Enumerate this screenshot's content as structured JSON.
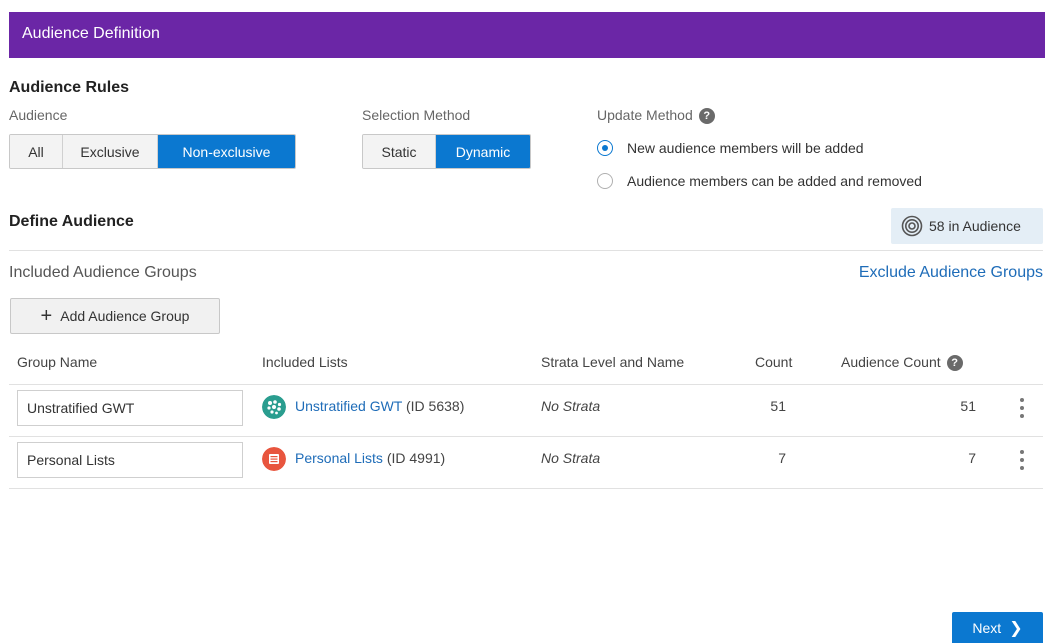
{
  "header": {
    "title": "Audience Definition"
  },
  "audience_rules": {
    "heading": "Audience Rules",
    "audience": {
      "label": "Audience",
      "options": [
        "All",
        "Exclusive",
        "Non-exclusive"
      ],
      "selected": "Non-exclusive"
    },
    "selection_method": {
      "label": "Selection Method",
      "options": [
        "Static",
        "Dynamic"
      ],
      "selected": "Dynamic"
    },
    "update_method": {
      "label": "Update Method",
      "help_icon": "?",
      "options": [
        {
          "label": "New audience members will be added",
          "checked": true
        },
        {
          "label": "Audience members can be added and removed",
          "checked": false
        }
      ]
    }
  },
  "define_audience": {
    "heading": "Define Audience",
    "audience_count_badge": "58 in Audience",
    "included_groups_label": "Included Audience Groups",
    "exclude_link": "Exclude Audience Groups",
    "add_group_button": "Add Audience Group",
    "add_icon": "+",
    "table": {
      "columns": [
        "Group Name",
        "Included Lists",
        "Strata Level and Name",
        "Count",
        "Audience Count"
      ],
      "rows": [
        {
          "group_name": "Unstratified GWT",
          "list_name": "Unstratified GWT",
          "list_id": "(ID 5638)",
          "list_icon": "dots-cluster-icon",
          "list_icon_color": "#2a9d8f",
          "strata": "No Strata",
          "count": "51",
          "audience_count": "51"
        },
        {
          "group_name": "Personal Lists",
          "list_name": "Personal Lists",
          "list_id": "(ID 4991)",
          "list_icon": "list-icon",
          "list_icon_color": "#e8553e",
          "strata": "No Strata",
          "count": "7",
          "audience_count": "7"
        }
      ]
    }
  },
  "footer": {
    "next_button": "Next",
    "next_icon": "❯"
  },
  "colors": {
    "header": "#6b26a6",
    "primary": "#0b78d0",
    "link": "#1e6cb8",
    "badge_bg": "#e4eef6"
  }
}
